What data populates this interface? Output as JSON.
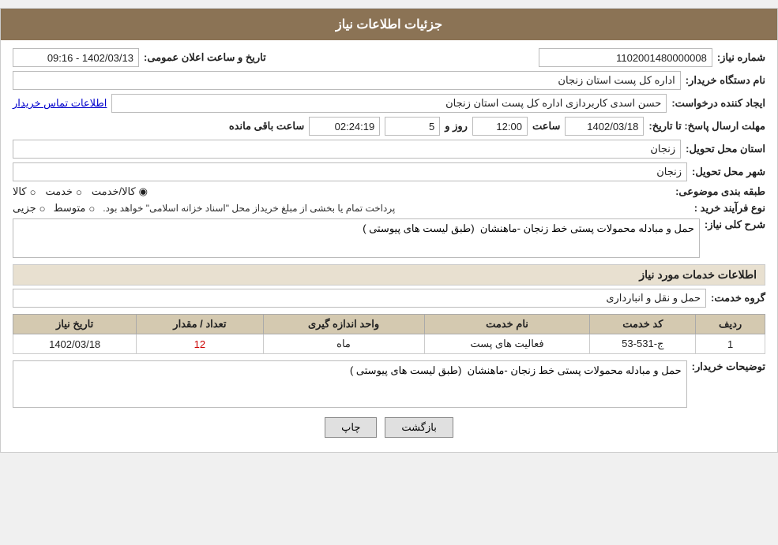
{
  "header": {
    "title": "جزئیات اطلاعات نیاز"
  },
  "fields": {
    "need_number_label": "شماره نیاز:",
    "need_number_value": "1102001480000008",
    "department_label": "نام دستگاه خریدار:",
    "department_value": "اداره کل پست استان زنجان",
    "announcement_label": "تاریخ و ساعت اعلان عمومی:",
    "announcement_value": "1402/03/13 - 09:16",
    "creator_label": "ایجاد کننده درخواست:",
    "creator_name": "حسن  اسدی کاربردازی اداره کل پست استان زنجان",
    "contact_link": "اطلاعات تماس خریدار",
    "deadline_label": "مهلت ارسال پاسخ: تا تاریخ:",
    "deadline_date": "1402/03/18",
    "deadline_time_label": "ساعت",
    "deadline_time": "12:00",
    "deadline_days_label": "روز و",
    "deadline_days": "5",
    "deadline_remaining_label": "ساعت باقی مانده",
    "deadline_remaining": "02:24:19",
    "province_label": "استان محل تحویل:",
    "province_value": "زنجان",
    "city_label": "شهر محل تحویل:",
    "city_value": "زنجان",
    "category_label": "طبقه بندی موضوعی:",
    "category_option1": "کالا",
    "category_option2": "خدمت",
    "category_option3": "کالا/خدمت",
    "purchase_type_label": "نوع فرآیند خرید :",
    "purchase_option1": "جزیی",
    "purchase_option2": "متوسط",
    "purchase_note": "پرداخت تمام یا بخشی از مبلغ خریداز محل \"اسناد خزانه اسلامی\" خواهد بود.",
    "need_desc_label": "شرح کلی نیاز:",
    "need_desc_value": "حمل و مبادله محمولات پستی خط زنجان -ماهنشان  (طبق لیست های پیوستی )",
    "services_header": "اطلاعات خدمات مورد نیاز",
    "service_group_label": "گروه خدمت:",
    "service_group_value": "حمل و نقل و انبارداری",
    "table": {
      "col_row": "ردیف",
      "col_code": "کد خدمت",
      "col_name": "نام خدمت",
      "col_unit": "واحد اندازه گیری",
      "col_count": "تعداد / مقدار",
      "col_date": "تاریخ نیاز",
      "rows": [
        {
          "row": "1",
          "code": "ج-531-53",
          "name": "فعالیت های پست",
          "unit": "ماه",
          "count": "12",
          "date": "1402/03/18"
        }
      ]
    },
    "buyer_notes_label": "توضیحات خریدار:",
    "buyer_notes_value": "حمل و مبادله محمولات پستی خط زنجان -ماهنشان  (طبق لیست های پیوستی )"
  },
  "buttons": {
    "print_label": "چاپ",
    "back_label": "بازگشت"
  }
}
